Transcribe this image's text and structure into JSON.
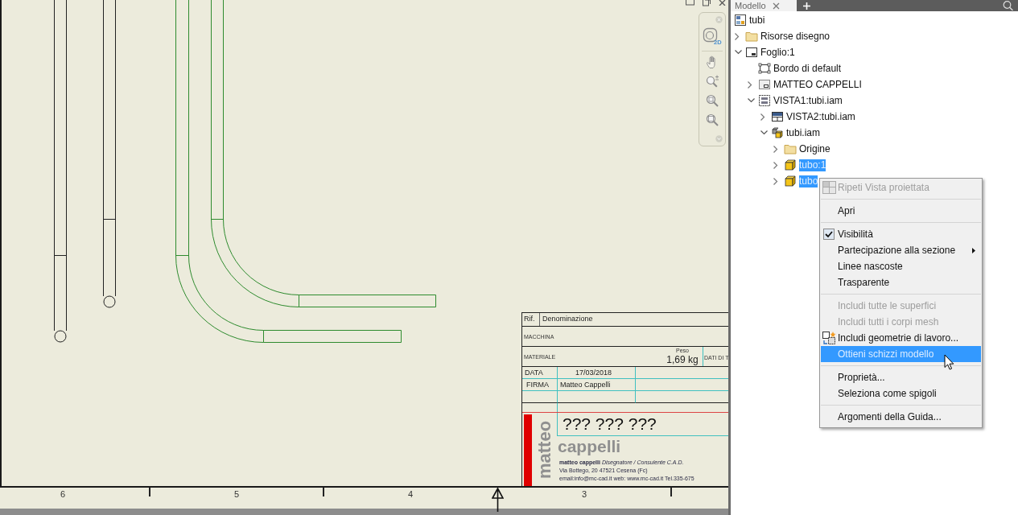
{
  "sheet": {
    "title_block": {
      "rif_label": "Rif.",
      "name_label": "Denominazione",
      "machine_label": "MACCHINA",
      "material_label": "MATERIALE",
      "weight_label": "Peso",
      "weight_value": "1,69 kg",
      "data_label": "DATI DI T",
      "date_label": "DATA",
      "date_value": "17/03/2018",
      "signature_label": "FIRMA",
      "signature_value": "Matteo Cappelli",
      "code": "??? ??? ???",
      "logo_first": "matteo",
      "logo_last": "cappelli",
      "company_lines": [
        "**matteo cappelli**  *Disegnatore / Consulente C.A.D.*",
        "Via Bottego, 20  47521 Cesena (Fc)",
        "email:info@mc-cad.it  web: www.mc-cad.it  Tel.335-675"
      ]
    },
    "navigation_bar": {
      "view_label": "2D"
    },
    "ruler": {
      "labels": [
        "6",
        "5",
        "4",
        "3"
      ]
    }
  },
  "browser": {
    "tabs": [
      {
        "label": "Modello",
        "selected": true
      }
    ],
    "tree": [
      {
        "label": "tubi",
        "kind": "drawing",
        "selected": false,
        "children": [
          {
            "label": "Risorse disegno",
            "kind": "folder",
            "expanded": false,
            "selected": false
          },
          {
            "label": "Foglio:1",
            "kind": "sheet",
            "expanded": true,
            "selected": false,
            "children": [
              {
                "label": "Bordo di default",
                "kind": "border",
                "selected": false
              },
              {
                "label": "MATTEO CAPPELLI",
                "kind": "title-block",
                "expanded": false,
                "selected": false
              },
              {
                "label": "VISTA1:tubi.iam",
                "kind": "base-view",
                "expanded": true,
                "selected": false,
                "children": [
                  {
                    "label": "VISTA2:tubi.iam",
                    "kind": "projected-view",
                    "expanded": false,
                    "selected": false
                  },
                  {
                    "label": "tubi.iam",
                    "kind": "assembly",
                    "expanded": true,
                    "selected": false,
                    "children": [
                      {
                        "label": "Origine",
                        "kind": "folder",
                        "expanded": false,
                        "selected": false
                      },
                      {
                        "label": "tubo:1",
                        "kind": "part",
                        "expanded": false,
                        "selected": true
                      },
                      {
                        "label": "tubo",
                        "kind": "part",
                        "expanded": false,
                        "selected": true
                      }
                    ]
                  }
                ]
              }
            ]
          }
        ]
      }
    ]
  },
  "context_menu": {
    "sections": [
      [
        {
          "label": "Ripeti Vista proiettata",
          "kind": "projected-view",
          "disabled": true,
          "selected": false
        }
      ],
      [
        {
          "label": "Apri",
          "kind": "plain",
          "disabled": false,
          "selected": false
        }
      ],
      [
        {
          "label": "Visibilità",
          "kind": "check",
          "checked": true,
          "disabled": false,
          "selected": false
        },
        {
          "label": "Partecipazione alla sezione",
          "kind": "submenu",
          "disabled": false,
          "selected": false
        },
        {
          "label": "Linee nascoste",
          "kind": "plain",
          "disabled": false,
          "selected": false
        },
        {
          "label": "Trasparente",
          "kind": "plain",
          "disabled": false,
          "selected": false
        }
      ],
      [
        {
          "label": "Includi tutte le superfici",
          "kind": "plain",
          "disabled": true,
          "selected": false
        },
        {
          "label": "Includi tutti i corpi mesh",
          "kind": "plain",
          "disabled": true,
          "selected": false
        },
        {
          "label": "Includi geometrie di lavoro...",
          "kind": "work-geometry",
          "disabled": false,
          "selected": false
        },
        {
          "label": "Ottieni schizzi modello",
          "kind": "plain",
          "disabled": false,
          "selected": true
        }
      ],
      [
        {
          "label": "Proprietà...",
          "kind": "plain",
          "disabled": false,
          "selected": false
        },
        {
          "label": "Seleziona come spigoli",
          "kind": "plain",
          "disabled": false,
          "selected": false
        }
      ],
      [
        {
          "label": "Argomenti della Guida...",
          "kind": "plain",
          "disabled": false,
          "selected": false
        }
      ]
    ]
  }
}
